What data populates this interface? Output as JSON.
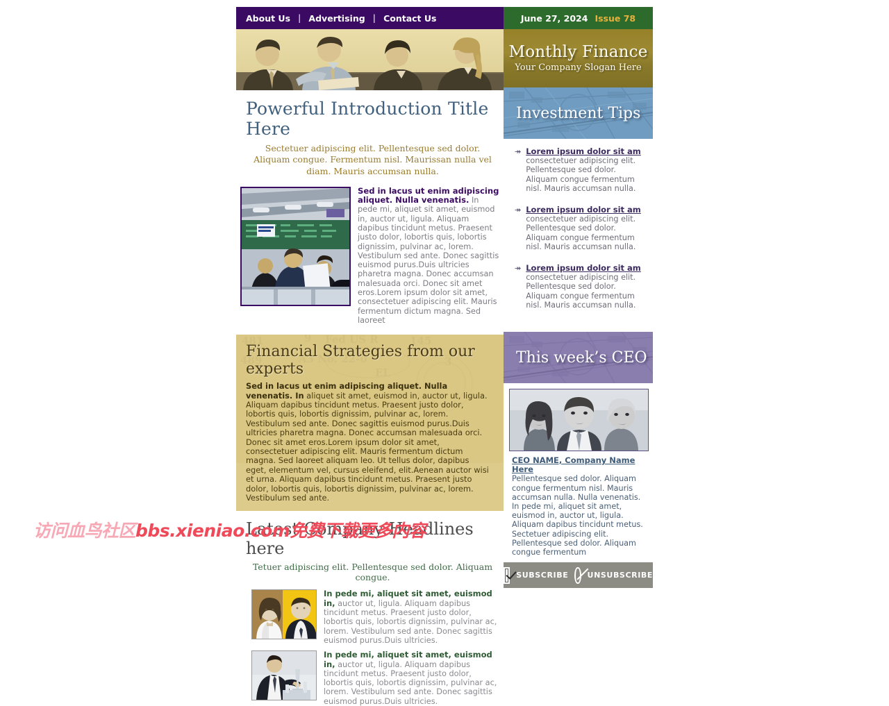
{
  "nav": {
    "items": [
      "About Us",
      "Advertising",
      "Contact Us"
    ],
    "separator": "|"
  },
  "issue_bar": {
    "date": "June 27, 2024",
    "issue": "Issue 78",
    "date_color": "#ffffff",
    "issue_color": "#e8b03a",
    "bg": "#2c6b2c"
  },
  "masthead": {
    "title": "Monthly Finance",
    "slogan": "Your Company Slogan Here",
    "bg": "#8b7a2a"
  },
  "hero": {
    "alt": "four business people seated in meeting, sepia duotone"
  },
  "intro": {
    "title": "Powerful Introduction Title Here",
    "title_color": "#41607d",
    "subtitle": "Sectetuer adipiscing elit. Pellentesque sed dolor.  Aliquam congue. Fermentum nisl. Maurissan nulla vel diam. Mauris accumsan nulla.",
    "subtitle_color": "#9a7c2e"
  },
  "article": {
    "image_alt": "busy trading floor terminal counter",
    "lead": "Sed in lacus ut enim adipiscing aliquet. Nulla venenatis.",
    "body": " In pede mi, aliquet sit amet, euismod in, auctor ut, ligula. Aliquam dapibus tincidunt metus. Praesent justo dolor, lobortis quis, lobortis dignissim, pulvinar ac, lorem. Vestibulum sed ante. Donec sagittis euismod purus.Duis ultricies pharetra magna. Donec accumsan malesuada orci. Donec sit amet eros.Lorem ipsum dolor sit amet, consectetuer adipiscing elit. Mauris fermentum dictum magna. Sed laoreet"
  },
  "strategies": {
    "title": "Financial Strategies from our experts",
    "lead": "Sed in lacus ut enim adipiscing aliquet. Nulla venenatis. In",
    "body": " aliquet sit amet, euismod in, auctor ut, ligula. Aliquam dapibus tincidunt metus. Praesent justo dolor, lobortis quis, lobortis dignissim, pulvinar ac, lorem. Vestibulum sed ante. Donec sagittis euismod purus.Duis ultricies pharetra magna. Donec accumsan malesuada orci. Donec sit amet eros.Lorem ipsum dolor sit amet, consectetuer adipiscing elit. Mauris fermentum dictum magna. Sed laoreet aliquam leo. Ut tellus dolor, dapibus eget, elementum vel, cursus eleifend, elit.Aenean auctor wisi et urna. Aliquam dapibus tincidunt metus. Praesent justo dolor, lobortis quis, lobortis dignissim, pulvinar ac, lorem. Vestibulum sed ante.",
    "bg": "#ddcb8b"
  },
  "headlines": {
    "title": "Latest Company Headlines here",
    "subtitle": "Tetuer adipiscing elit. Pellentesque sed dolor.  Aliquam congue.",
    "subtitle_color": "#3f6b46",
    "items": [
      {
        "image_alt": "man and woman portrait on yellow background",
        "lead": "In pede mi, aliquet sit amet, euismod in,",
        "body": " auctor ut, ligula. Aliquam dapibus tincidunt metus. Praesent justo dolor, lobortis quis, lobortis dignissim, pulvinar ac, lorem. Vestibulum sed ante. Donec sagittis euismod purus.Duis ultricies."
      },
      {
        "image_alt": "man in suit pouring champagne",
        "lead": "In pede mi, aliquet sit amet, euismod in,",
        "body": " auctor ut, ligula. Aliquam dapibus tincidunt metus. Praesent justo dolor, lobortis quis, lobortis dignissim, pulvinar ac, lorem. Vestibulum sed ante. Donec sagittis euismod purus.Duis ultricies."
      }
    ]
  },
  "investment_tips": {
    "banner_title": "Investment Tips",
    "banner_bg": "#6f9cc0",
    "bullet": "↠",
    "items": [
      {
        "link": "Lorem ipsum dolor sit am",
        "body": " consectetuer adipiscing elit. Pellentesque sed dolor. Aliquam congue fermentum nisl. Mauris accumsan nulla."
      },
      {
        "link": "Lorem ipsum dolor sit am",
        "body": " consectetuer adipiscing elit. Pellentesque sed dolor. Aliquam congue fermentum nisl. Mauris accumsan nulla."
      },
      {
        "link": "Lorem ipsum dolor sit am",
        "body": " consectetuer adipiscing elit. Pellentesque sed dolor. Aliquam congue fermentum nisl. Mauris accumsan nulla."
      }
    ]
  },
  "ceo": {
    "banner_title": "This week’s CEO",
    "banner_bg": "#8a7eae",
    "image_alt": "three executives greyscale portrait",
    "link": "CEO NAME, Company Name Here",
    "body": "Pellentesque sed dolor. Aliquam congue fermentum nisl. Mauris accumsan nulla. Nulla venenatis. In pede mi, aliquet sit amet, euismod in, auctor ut, ligula. Aliquam dapibus tincidunt metus. Sectetuer adipiscing elit. Pellentesque sed dolor. Aliquam congue fermentum"
  },
  "subscribe_bar": {
    "subscribe_label": "SUBSCRIBE",
    "unsubscribe_label": "UNSUBSCRIBE",
    "bg": "#8c8c84"
  },
  "watermark": {
    "text_left": "访问血鸟社区",
    "text_mid": "bbs.xieniao.com",
    "text_right": "免费下载更多内容"
  }
}
